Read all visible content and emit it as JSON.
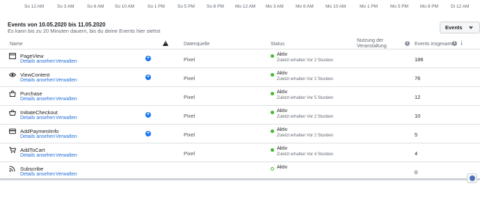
{
  "timeline": {
    "ticks": [
      "So 12 AM",
      "So 3 AM",
      "So 6 AM",
      "So 10 AM",
      "So 1 PM",
      "So 5 PM",
      "So 8 PM",
      "Mo 12 AM",
      "Mo 3 AM",
      "Mo 6 AM",
      "Mo 10 AM",
      "Mo 1 PM",
      "Mo 5 PM",
      "Mo 8 PM",
      "Di 12 AM"
    ]
  },
  "header": {
    "title": "Events von 10.05.2020 bis 11.05.2020",
    "subtitle": "Es kann bis zu 20 Minuten dauern, bis du deine Events hier siehst",
    "events_button": "Events"
  },
  "table": {
    "columns": {
      "name": "Name",
      "source": "Datenquelle",
      "status": "Status",
      "usage": "Nutzung der Veranstaltung",
      "total": "Events insgesamt"
    },
    "links": {
      "details": "Details ansehen",
      "manage": "Verwalten"
    },
    "rows": [
      {
        "name": "PageView",
        "icon": "page-icon",
        "plus": true,
        "source": "Pixel",
        "status": "Aktiv",
        "received": "Zuletzt erhalten Vor 2 Stunden",
        "total": "186",
        "hollow": false
      },
      {
        "name": "ViewContent",
        "icon": "eye-icon",
        "plus": true,
        "source": "Pixel",
        "status": "Aktiv",
        "received": "Zuletzt erhalten Vor 2 Stunden",
        "total": "76",
        "hollow": false
      },
      {
        "name": "Purchase",
        "icon": "shopping-bag-icon",
        "plus": false,
        "source": "Pixel",
        "status": "Aktiv",
        "received": "Zuletzt erhalten Vor 5 Stunden",
        "total": "12",
        "hollow": false
      },
      {
        "name": "InitiateCheckout",
        "icon": "basket-icon",
        "plus": true,
        "source": "Pixel",
        "status": "Aktiv",
        "received": "Zuletzt erhalten Vor 2 Stunden",
        "total": "10",
        "hollow": false
      },
      {
        "name": "AddPaymentInfo",
        "icon": "credit-card-icon",
        "plus": true,
        "source": "Pixel",
        "status": "Aktiv",
        "received": "Zuletzt erhalten Vor 2 Stunden",
        "total": "5",
        "hollow": false
      },
      {
        "name": "AddToCart",
        "icon": "cart-icon",
        "plus": false,
        "source": "Pixel",
        "status": "Aktiv",
        "received": "Zuletzt erhalten Vor 4 Stunden",
        "total": "4",
        "hollow": false
      },
      {
        "name": "Subscribe",
        "icon": "rss-icon",
        "plus": false,
        "source": "",
        "status": "Aktiv",
        "received": "",
        "total": "0",
        "hollow": true
      }
    ]
  },
  "colors": {
    "link": "#216fdb",
    "active": "#42b72a",
    "plus": "#1877f2"
  }
}
